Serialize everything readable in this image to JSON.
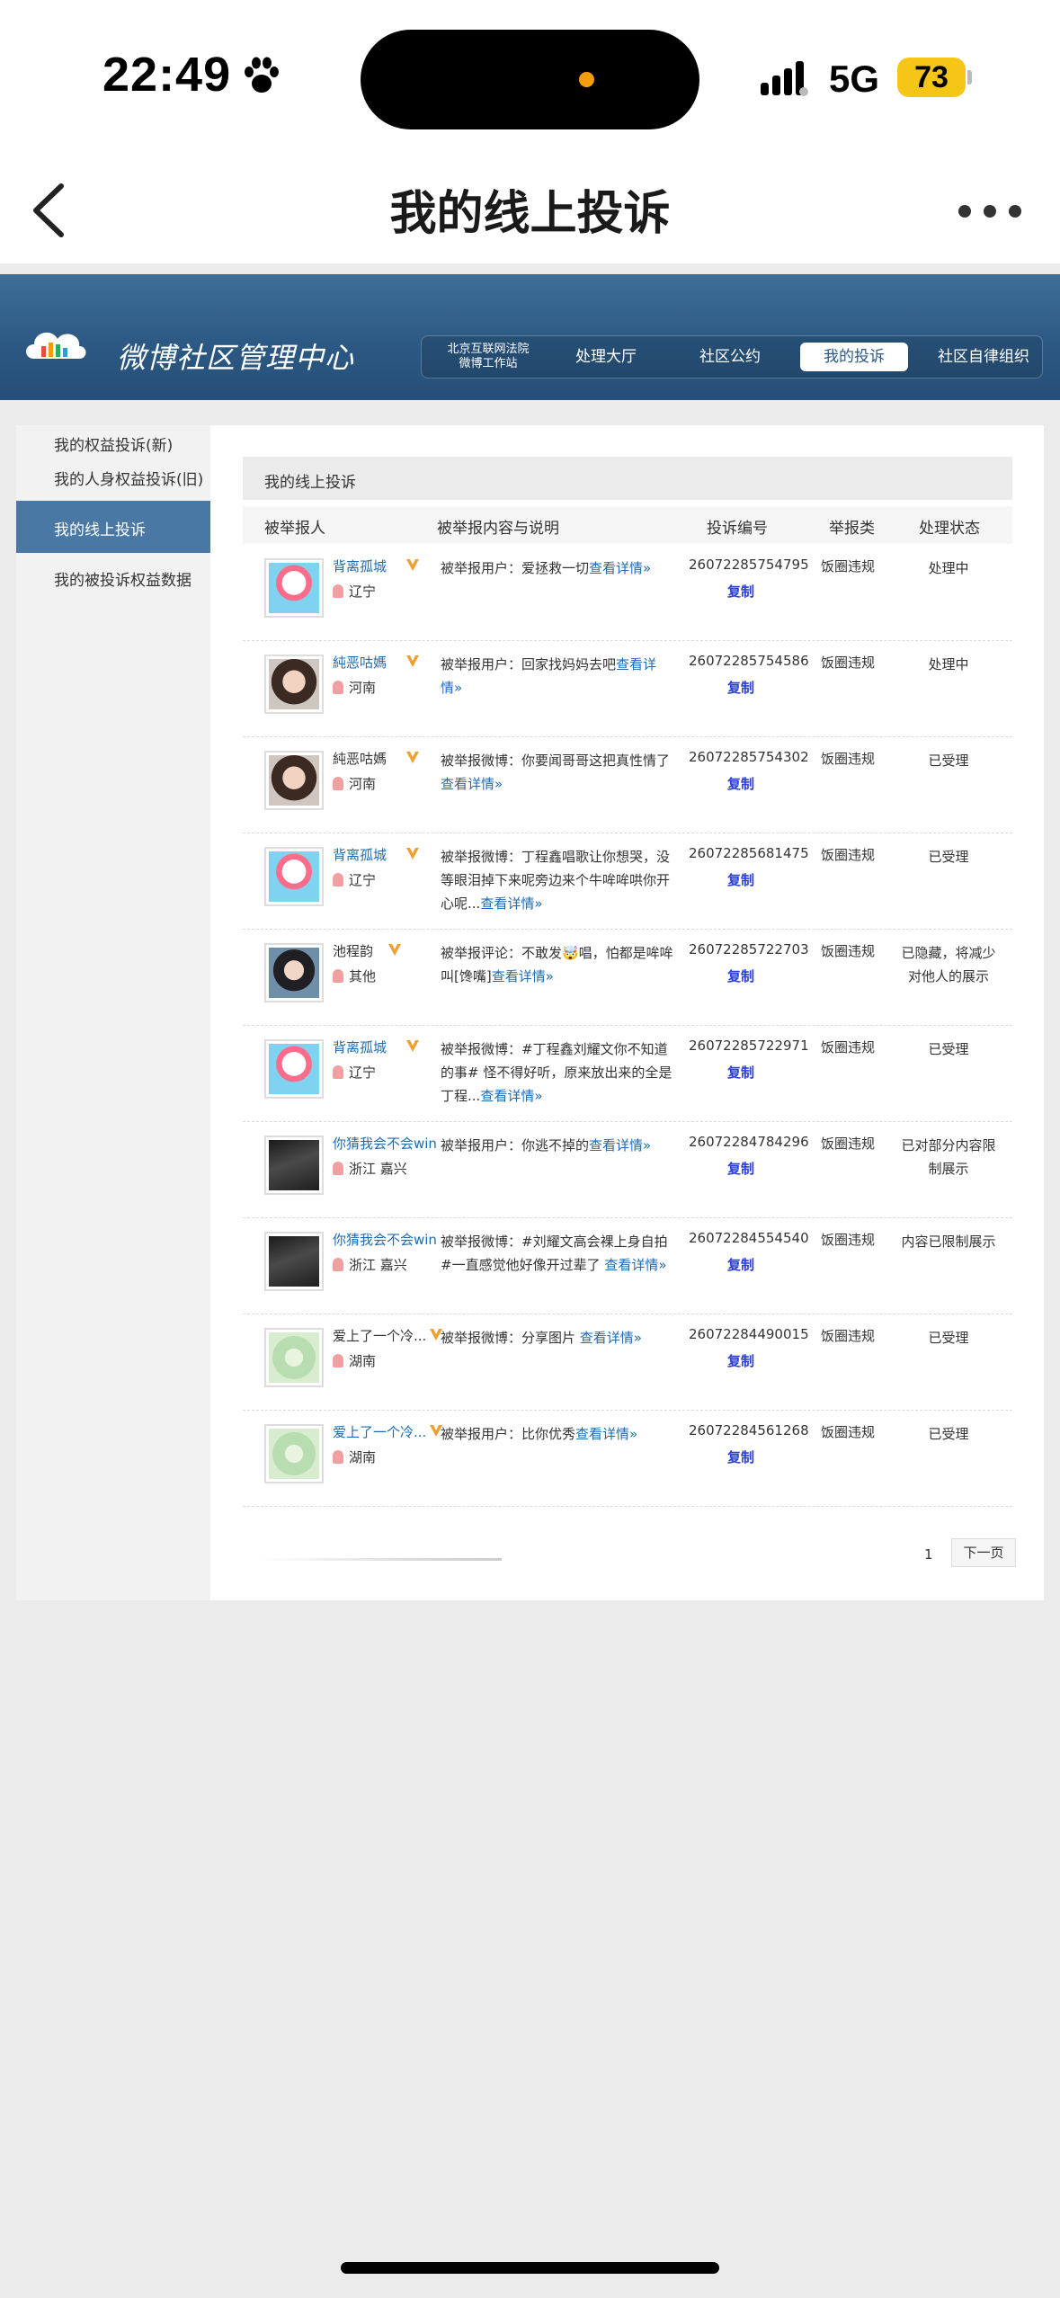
{
  "status_bar": {
    "time": "22:49",
    "network": "5G",
    "battery": "73"
  },
  "nav": {
    "title": "我的线上投诉"
  },
  "weibo": {
    "title": "微博社区管理中心",
    "tabs": [
      "北京互联网法院\n微博工作站",
      "处理大厅",
      "社区公约",
      "我的投诉",
      "社区自律组织"
    ],
    "active_tab": "我的投诉"
  },
  "sidebar": {
    "items": [
      "我的权益投诉(新)",
      "我的人身权益投诉(旧)",
      "我的线上投诉",
      "我的被投诉权益数据"
    ],
    "active": "我的线上投诉"
  },
  "content": {
    "title": "我的线上投诉",
    "headers": [
      "被举报人",
      "被举报内容与说明",
      "投诉编号",
      "举报类",
      "处理状态"
    ],
    "copy_label": "复制",
    "rows": [
      {
        "user": "背离孤城",
        "location": "辽宁",
        "desc": "被举报用户：爱拯救一切",
        "link": "查看详情»",
        "id": "26072285754795",
        "category": "饭圈违规",
        "status": "处理中",
        "avatar": "pink"
      },
      {
        "user": "純恶咕媽",
        "location": "河南",
        "desc": "被举报用户：回家找妈妈去吧",
        "link": "查看详情»",
        "id": "26072285754586",
        "category": "饭圈违规",
        "status": "处理中",
        "avatar": "girl"
      },
      {
        "user": "純恶咕媽",
        "location": "河南",
        "desc": "被举报微博：你要闻哥哥这把真性情了",
        "link": "查看详情»",
        "id": "26072285754302",
        "category": "饭圈违规",
        "status": "已受理",
        "avatar": "girl"
      },
      {
        "user": "背离孤城",
        "location": "辽宁",
        "desc": "被举报微博：丁程鑫唱歌让你想哭，没等眼泪掉下来呢旁边来个牛哞哞哄你开心呢...",
        "link": "查看详情»",
        "id": "26072285681475",
        "category": "饭圈违规",
        "status": "已受理",
        "avatar": "pink"
      },
      {
        "user": "池程韵",
        "location": "其他",
        "desc": "被举报评论：不敢发🤯唱，怕都是哞哞叫[馋嘴]",
        "link": "查看详情»",
        "id": "26072285722703",
        "category": "饭圈违规",
        "status": "已隐藏，将减少对他人的展示",
        "avatar": "boy"
      },
      {
        "user": "背离孤城",
        "location": "辽宁",
        "desc": "被举报微博：#丁程鑫刘耀文你不知道的事# 怪不得好听，原来放出来的全是丁程...",
        "link": "查看详情»",
        "id": "26072285722971",
        "category": "饭圈违规",
        "status": "已受理",
        "avatar": "pink"
      },
      {
        "user": "你猜我会不会win",
        "location": "浙江 嘉兴",
        "desc": "被举报用户：你逃不掉的",
        "link": "查看详情»",
        "id": "26072284784296",
        "category": "饭圈违规",
        "status": "已对部分内容限制展示",
        "avatar": "dark"
      },
      {
        "user": "你猜我会不会win",
        "location": "浙江 嘉兴",
        "desc": "被举报微博：#刘耀文高会裸上身自拍#一直感觉他好像开过辈了 ",
        "link": "查看详情»",
        "id": "26072284554540",
        "category": "饭圈违规",
        "status": "内容已限制展示",
        "avatar": "dark"
      },
      {
        "user": "爱上了一个冷...",
        "location": "湖南",
        "desc": "被举报微博：分享图片 ",
        "link": "查看详情»",
        "id": "26072284490015",
        "category": "饭圈违规",
        "status": "已受理",
        "avatar": "green"
      },
      {
        "user": "爱上了一个冷...",
        "location": "湖南",
        "desc": "被举报用户：比你优秀",
        "link": "查看详情»",
        "id": "26072284561268",
        "category": "饭圈违规",
        "status": "已受理",
        "avatar": "green"
      }
    ]
  },
  "pager": {
    "page": "1",
    "next": "下一页"
  },
  "colors": {
    "header_blue": "#2c5984",
    "link_blue": "#1d6bb3",
    "copy_blue": "#2c3fd9",
    "active_side": "#4a78a5",
    "battery": "#f5c518"
  }
}
